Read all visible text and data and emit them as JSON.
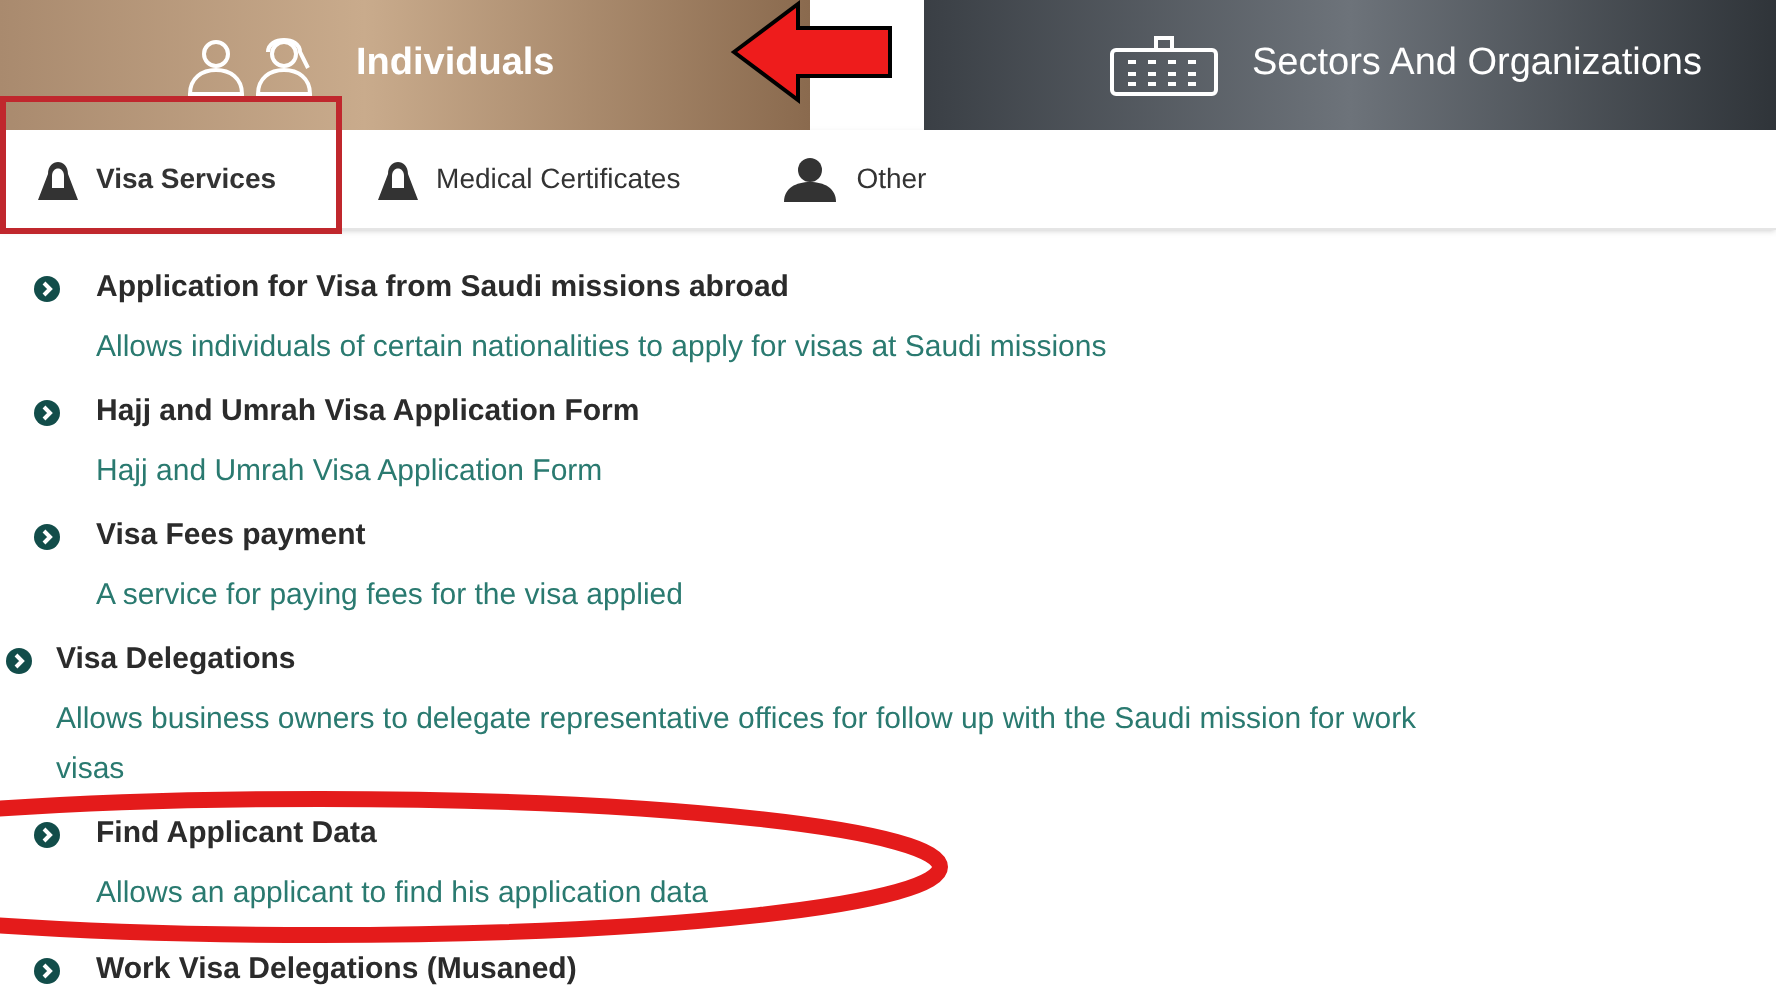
{
  "header_tabs": [
    {
      "label": "Individuals",
      "selected": true,
      "kind": "individuals"
    },
    {
      "label": "Sectors And Organizations",
      "selected": false,
      "kind": "sectors"
    }
  ],
  "service_tabs": [
    {
      "label": "Visa Services",
      "selected": true,
      "kind": "bag"
    },
    {
      "label": "Medical Certificates",
      "selected": false,
      "kind": "bag"
    },
    {
      "label": "Other",
      "selected": false,
      "kind": "person"
    }
  ],
  "services": [
    {
      "title": "Application for Visa from Saudi missions abroad",
      "description": "Allows individuals of certain nationalities to apply for visas at Saudi missions",
      "kind": "inner"
    },
    {
      "title": "Hajj and Umrah Visa Application Form",
      "description": "Hajj and Umrah Visa Application Form",
      "kind": "inner"
    },
    {
      "title": "Visa Fees payment",
      "description": "A service for paying fees for the visa applied",
      "kind": "inner"
    },
    {
      "title": "Visa Delegations",
      "description": "Allows business owners to delegate representative offices for follow up with the Saudi mission for work visas",
      "kind": "outer"
    },
    {
      "title": "Find Applicant Data",
      "description": "Allows an applicant to find his application data",
      "kind": "inner",
      "circled": true
    },
    {
      "title": "Work Visa Delegations (Musaned)",
      "kind": "inner"
    }
  ]
}
